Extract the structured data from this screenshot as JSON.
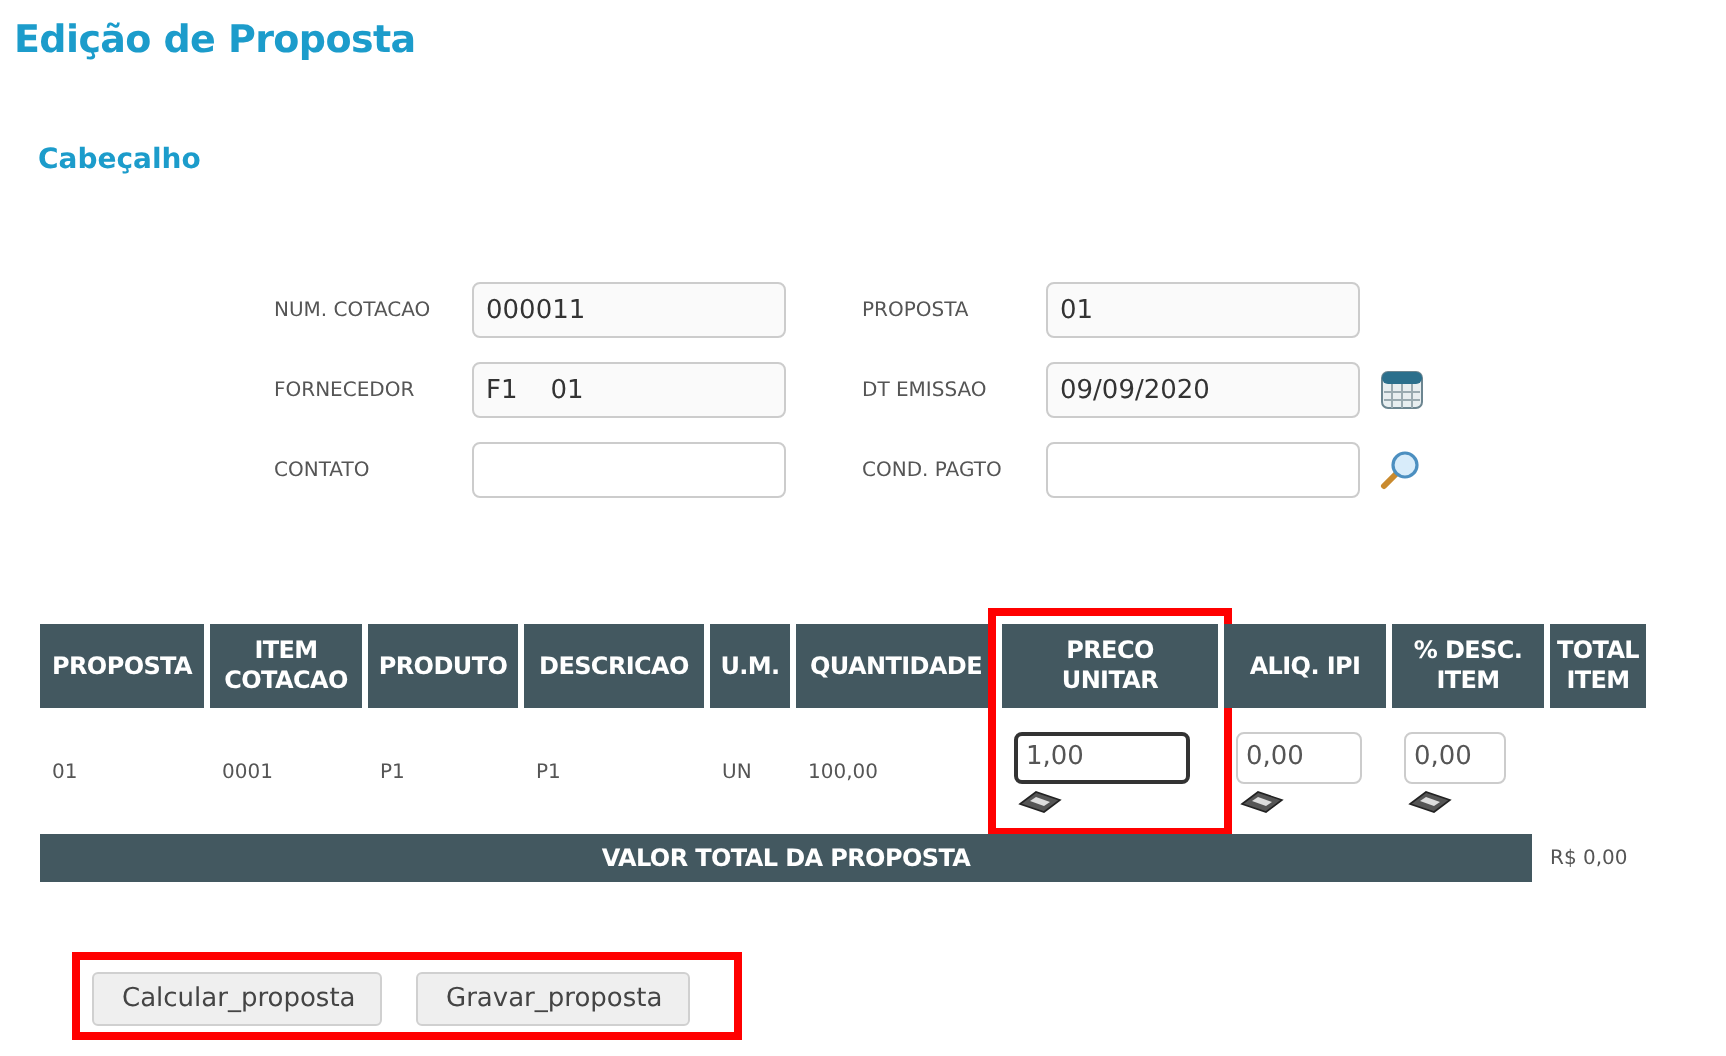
{
  "title": "Edição de Proposta",
  "section": "Cabeçalho",
  "fields": [
    {
      "label": "NUM. COTACAO",
      "value": "000011",
      "kind": "text"
    },
    {
      "label": "PROPOSTA",
      "value": "01",
      "kind": "text"
    },
    {
      "label": "FORNECEDOR",
      "value": "F1    01",
      "kind": "text"
    },
    {
      "label": "DT EMISSAO",
      "value": "09/09/2020",
      "kind": "date"
    },
    {
      "label": "CONTATO",
      "kind": "text"
    },
    {
      "label": "COND. PAGTO",
      "kind": "lookup"
    }
  ],
  "table": {
    "columns": [
      {
        "label": "PROPOSTA",
        "highlighted": false
      },
      {
        "label": "ITEM\nCOTACAO",
        "highlighted": false
      },
      {
        "label": "PRODUTO",
        "highlighted": false
      },
      {
        "label": "DESCRICAO",
        "highlighted": false
      },
      {
        "label": "U.M.",
        "highlighted": false
      },
      {
        "label": "QUANTIDADE",
        "highlighted": false
      },
      {
        "label": "PRECO\nUNITAR",
        "highlighted": true
      },
      {
        "label": "ALIQ. IPI",
        "highlighted": false
      },
      {
        "label": "% DESC.\nITEM",
        "highlighted": false
      },
      {
        "label": "TOTAL\nITEM",
        "highlighted": false
      }
    ],
    "rows": [
      {
        "cells": [
          {
            "kind": "text",
            "value": "01"
          },
          {
            "kind": "text",
            "value": "0001"
          },
          {
            "kind": "text",
            "value": "P1"
          },
          {
            "kind": "text",
            "value": "P1"
          },
          {
            "kind": "text",
            "value": "UN"
          },
          {
            "kind": "text",
            "value": "100,00"
          },
          {
            "kind": "input",
            "value": "1,00",
            "focused": true
          },
          {
            "kind": "input",
            "value": "0,00",
            "focused": false
          },
          {
            "kind": "input",
            "value": "0,00",
            "focused": false
          }
        ]
      }
    ]
  },
  "total": {
    "label": "VALOR TOTAL DA PROPOSTA",
    "value": "R$ 0,00"
  },
  "actions": {
    "highlighted": true,
    "buttons": [
      "Calcular_proposta",
      "Gravar_proposta"
    ]
  }
}
